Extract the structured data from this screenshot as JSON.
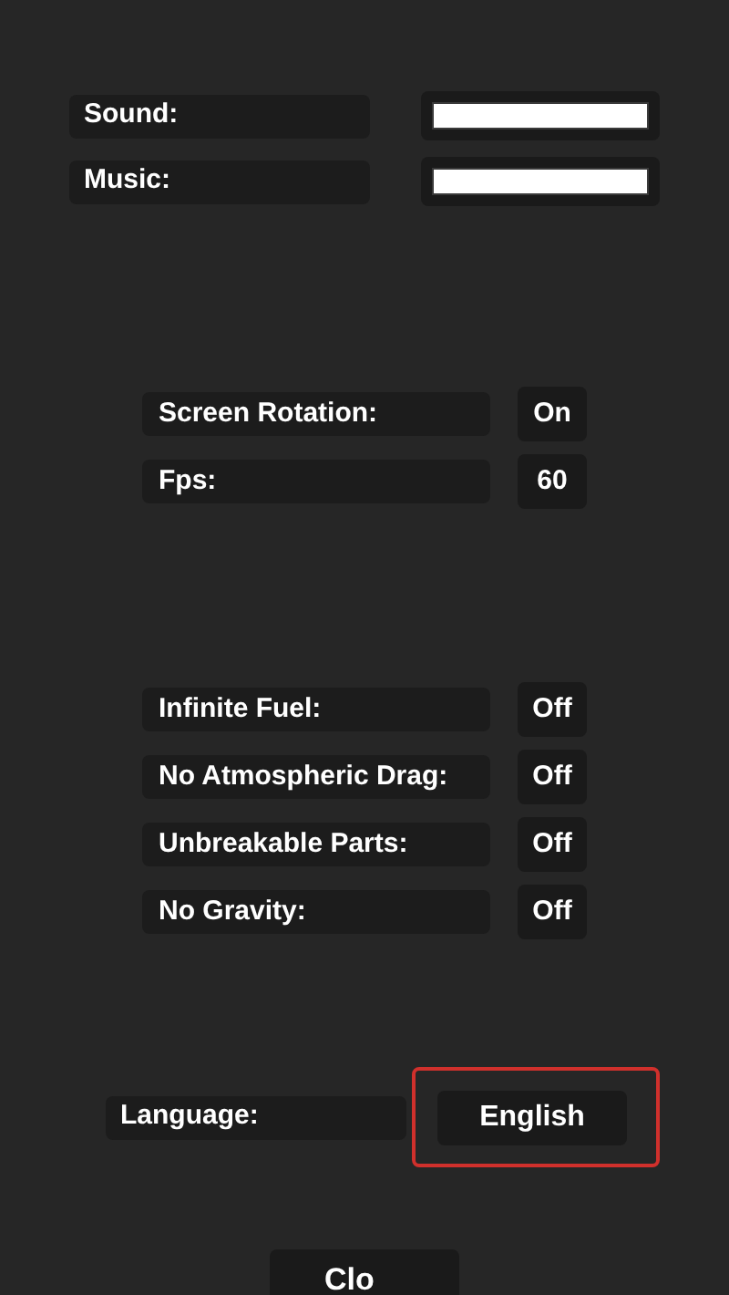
{
  "audio": [
    {
      "label": "Sound:",
      "level": 1
    },
    {
      "label": "Music:",
      "level": 1
    }
  ],
  "display": [
    {
      "label": "Screen Rotation:",
      "value": "On"
    },
    {
      "label": "Fps:",
      "value": "60"
    }
  ],
  "cheats": [
    {
      "label": "Infinite Fuel:",
      "value": "Off"
    },
    {
      "label": "No Atmospheric Drag:",
      "value": "Off"
    },
    {
      "label": "Unbreakable Parts:",
      "value": "Off"
    },
    {
      "label": "No Gravity:",
      "value": "Off"
    }
  ],
  "language": {
    "label": "Language:",
    "value": "English",
    "highlighted": true
  },
  "close_button": "Clo"
}
